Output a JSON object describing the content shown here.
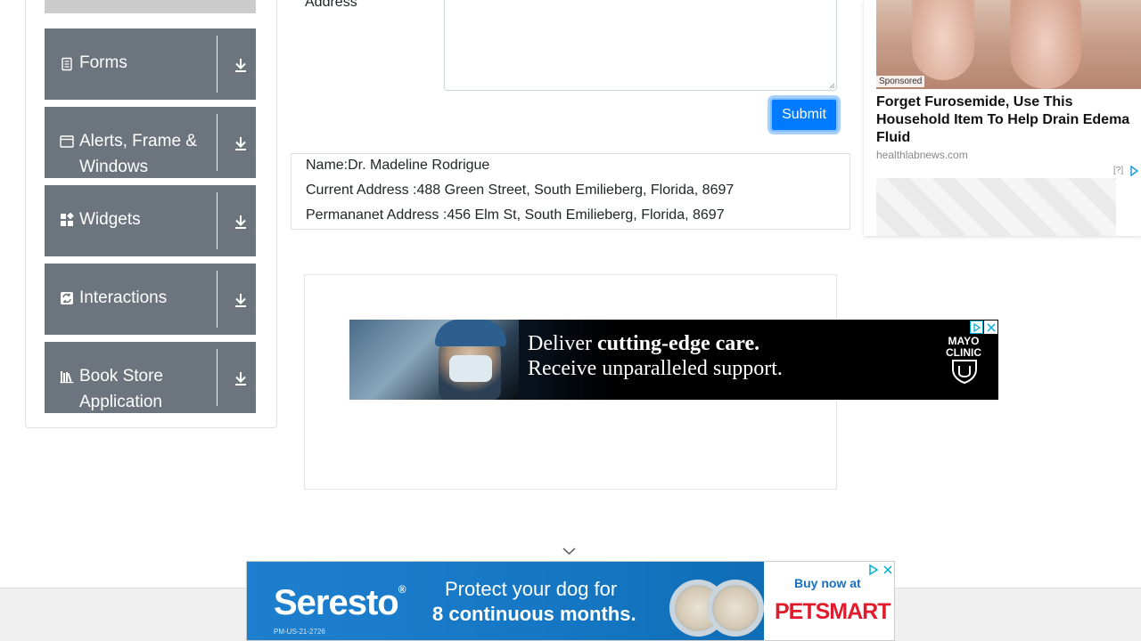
{
  "sidebar": {
    "groups": [
      {
        "label": "Forms",
        "icon": "form-icon"
      },
      {
        "label": "Alerts, Frame & Windows",
        "icon": "window-icon"
      },
      {
        "label": "Widgets",
        "icon": "widgets-icon"
      },
      {
        "label": "Interactions",
        "icon": "interactions-icon"
      },
      {
        "label": "Book Store Application",
        "icon": "books-icon"
      }
    ]
  },
  "form": {
    "address_label": "Address",
    "submit_label": "Submit"
  },
  "output": {
    "name": "Name:Dr. Madeline Rodrigue",
    "current_address": "Current Address :488 Green Street, South Emilieberg, Florida, 8697",
    "permanent_address": "Permananet Address :456 Elm St, South Emilieberg, Florida, 8697"
  },
  "ads": {
    "mayo": {
      "line1_prefix": "Deliver ",
      "line1_bold": "cutting-edge care.",
      "line2": "Receive unparalleled support.",
      "brand_top": "MAYO",
      "brand_bottom": "CLINIC"
    },
    "sponsored_card": {
      "badge": "Sponsored",
      "title": "Forget Furosemide, Use This Household Item To Help Drain Edema Fluid",
      "source": "healthlabnews.com",
      "help": "[?]"
    },
    "seresto": {
      "brand": "Seresto",
      "code": "PM-US-21-2726",
      "line1": "Protect your dog for",
      "line2": "8 continuous months.",
      "cta": "Buy now at",
      "retailer": "PETSMART"
    }
  },
  "colors": {
    "sidebar_group": "#6c757d",
    "primary": "#007bff"
  }
}
